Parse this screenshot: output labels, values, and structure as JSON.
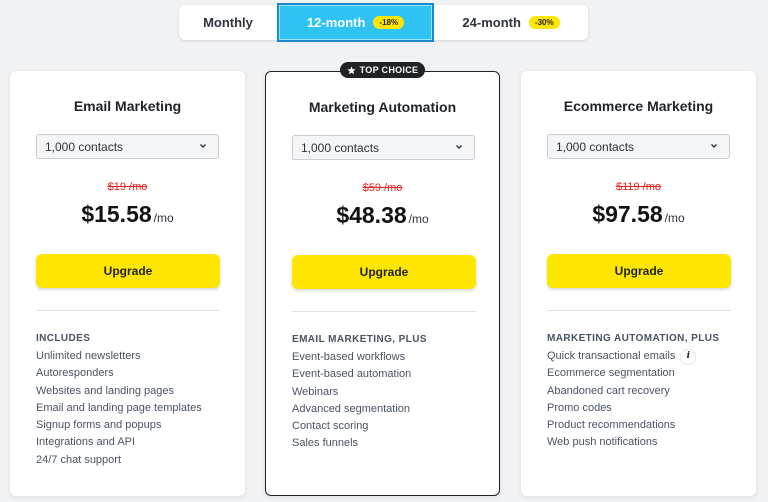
{
  "billing": {
    "options": [
      {
        "label": "Monthly",
        "badge": ""
      },
      {
        "label": "12-month",
        "badge": "-18%"
      },
      {
        "label": "24-month",
        "badge": "-30%"
      }
    ],
    "selected": "12-month"
  },
  "top_choice": "TOP CHOICE",
  "plans": [
    {
      "title": "Email Marketing",
      "contacts": "1,000 contacts",
      "old_price": "$19 /mo",
      "price": "$15.58",
      "per": "/mo",
      "cta": "Upgrade",
      "features_heading": "INCLUDES",
      "features": [
        "Unlimited newsletters",
        "Autoresponders",
        "Websites and landing pages",
        "Email and landing page templates",
        "Signup forms and popups",
        "Integrations and API",
        "24/7 chat support"
      ]
    },
    {
      "title": "Marketing Automation",
      "contacts": "1,000 contacts",
      "old_price": "$59 /mo",
      "price": "$48.38",
      "per": "/mo",
      "cta": "Upgrade",
      "features_heading": "EMAIL MARKETING, PLUS",
      "features": [
        "Event-based workflows",
        "Event-based automation",
        "Webinars",
        "Advanced segmentation",
        "Contact scoring",
        "Sales funnels"
      ]
    },
    {
      "title": "Ecommerce Marketing",
      "contacts": "1,000 contacts",
      "old_price": "$119 /mo",
      "price": "$97.58",
      "per": "/mo",
      "cta": "Upgrade",
      "features_heading": "MARKETING AUTOMATION, PLUS",
      "features": [
        "Quick transactional emails",
        "Ecommerce segmentation",
        "Abandoned cart recovery",
        "Promo codes",
        "Product recommendations",
        "Web push notifications"
      ],
      "info_icon_glyph": "i"
    }
  ],
  "colors": {
    "selected_tab": "#2fc3f4",
    "cta": "#ffe600",
    "strikethrough": "#e02424"
  }
}
